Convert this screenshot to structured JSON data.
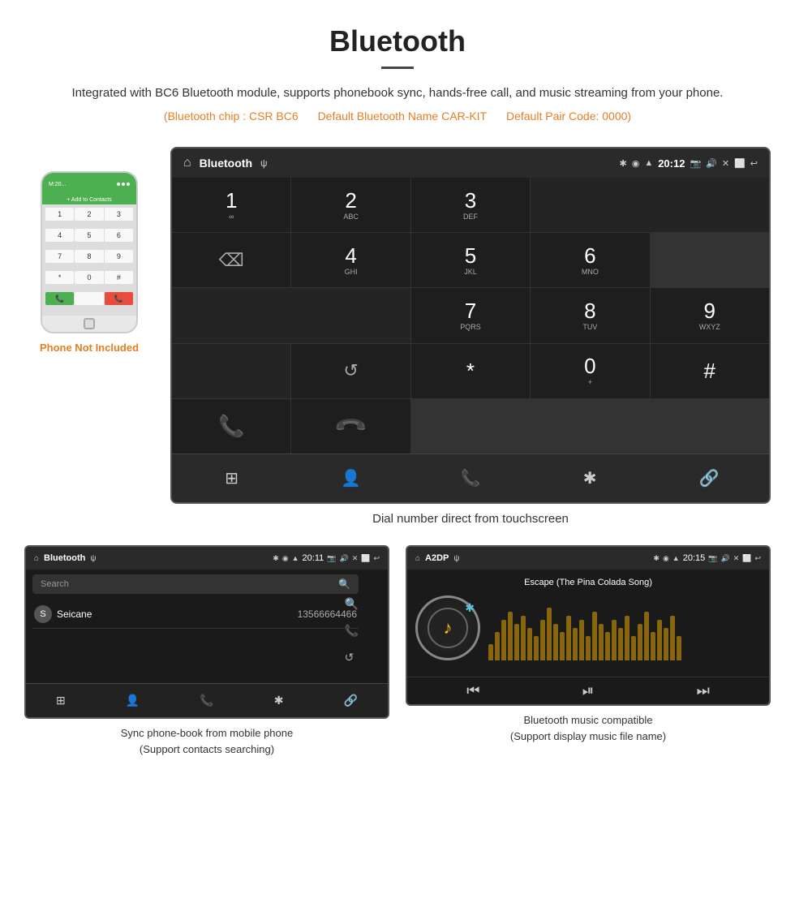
{
  "header": {
    "title": "Bluetooth",
    "description": "Integrated with BC6 Bluetooth module, supports phonebook sync, hands-free call, and music streaming from your phone.",
    "specs": [
      "(Bluetooth chip : CSR BC6",
      "Default Bluetooth Name CAR-KIT",
      "Default Pair Code: 0000)"
    ]
  },
  "phone_label": "Phone Not Included",
  "dial_screen": {
    "status_title": "Bluetooth",
    "status_usb": "ψ",
    "status_time": "20:12",
    "keys": [
      {
        "number": "1",
        "letters": "∞"
      },
      {
        "number": "2",
        "letters": "ABC"
      },
      {
        "number": "3",
        "letters": "DEF"
      },
      {
        "number": "",
        "letters": ""
      },
      {
        "number": "⌫",
        "letters": ""
      },
      {
        "number": "4",
        "letters": "GHI"
      },
      {
        "number": "5",
        "letters": "JKL"
      },
      {
        "number": "6",
        "letters": "MNO"
      },
      {
        "number": "",
        "letters": ""
      },
      {
        "number": "",
        "letters": ""
      },
      {
        "number": "7",
        "letters": "PQRS"
      },
      {
        "number": "8",
        "letters": "TUV"
      },
      {
        "number": "9",
        "letters": "WXYZ"
      },
      {
        "number": "",
        "letters": ""
      },
      {
        "number": "↺",
        "letters": ""
      },
      {
        "number": "*",
        "letters": ""
      },
      {
        "number": "0",
        "letters": "+"
      },
      {
        "number": "#",
        "letters": ""
      },
      {
        "number": "📞",
        "letters": ""
      },
      {
        "number": "📞red",
        "letters": ""
      }
    ],
    "bottom_icons": [
      "⊞",
      "👤",
      "📞",
      "✱",
      "🔗"
    ],
    "caption": "Dial number direct from touchscreen"
  },
  "phonebook_screen": {
    "status_title": "Bluetooth",
    "status_time": "20:11",
    "search_placeholder": "Search",
    "contact": {
      "initial": "S",
      "name": "Seicane",
      "number": "13566664466"
    },
    "bottom_icons": [
      "⊞",
      "👤",
      "📞",
      "✱",
      "🔗"
    ],
    "caption_line1": "Sync phone-book from mobile phone",
    "caption_line2": "(Support contacts searching)"
  },
  "music_screen": {
    "status_title": "A2DP",
    "status_time": "20:15",
    "song_title": "Escape (The Pina Colada Song)",
    "eq_heights": [
      20,
      35,
      50,
      60,
      45,
      55,
      40,
      30,
      50,
      65,
      45,
      35,
      55,
      40,
      50,
      30,
      60,
      45,
      35,
      50,
      40,
      55,
      30,
      45,
      60,
      35,
      50,
      40,
      55,
      30
    ],
    "caption_line1": "Bluetooth music compatible",
    "caption_line2": "(Support display music file name)"
  }
}
